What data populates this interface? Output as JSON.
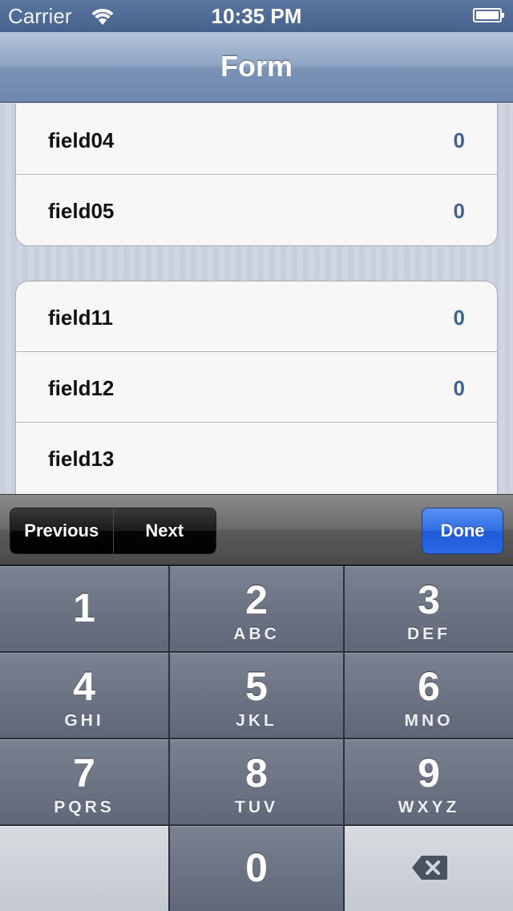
{
  "status_bar": {
    "carrier": "Carrier",
    "time": "10:35 PM",
    "wifi_icon": "wifi-icon",
    "battery_icon": "battery-icon"
  },
  "nav": {
    "title": "Form"
  },
  "groups": [
    {
      "cells": [
        {
          "label": "field04",
          "value": "0"
        },
        {
          "label": "field05",
          "value": "0"
        }
      ]
    },
    {
      "cells": [
        {
          "label": "field11",
          "value": "0"
        },
        {
          "label": "field12",
          "value": "0"
        },
        {
          "label": "field13",
          "value": ""
        }
      ]
    }
  ],
  "toolbar": {
    "previous_label": "Previous",
    "next_label": "Next",
    "done_label": "Done"
  },
  "keypad": {
    "keys": [
      {
        "num": "1",
        "letters": ""
      },
      {
        "num": "2",
        "letters": "ABC"
      },
      {
        "num": "3",
        "letters": "DEF"
      },
      {
        "num": "4",
        "letters": "GHI"
      },
      {
        "num": "5",
        "letters": "JKL"
      },
      {
        "num": "6",
        "letters": "MNO"
      },
      {
        "num": "7",
        "letters": "PQRS"
      },
      {
        "num": "8",
        "letters": "TUV"
      },
      {
        "num": "9",
        "letters": "WXYZ"
      },
      {
        "num": "0",
        "letters": ""
      }
    ],
    "delete_icon": "backspace-icon"
  },
  "colors": {
    "nav_blue": "#7a92b5",
    "value_blue": "#3e6591",
    "done_blue": "#2f6de6",
    "key_gray": "#5f6778"
  }
}
